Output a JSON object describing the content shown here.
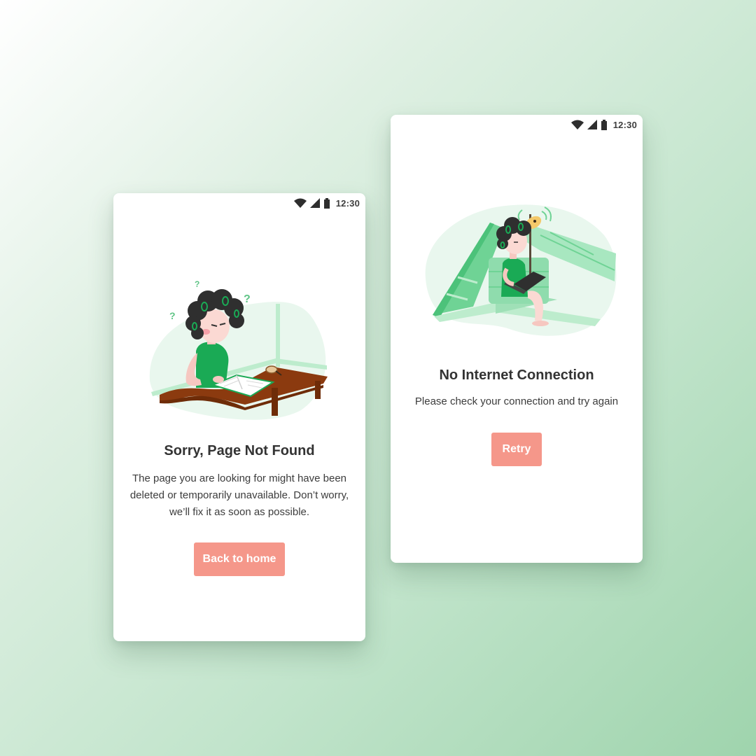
{
  "colors": {
    "background_start": "#ffffff",
    "background_end": "#9fd4ad",
    "button": "#f5978a",
    "accent_green": "#1aaa55",
    "mint": "#bdeccd"
  },
  "screens": [
    {
      "status_bar": {
        "time": "12:30",
        "icons": [
          "wifi-icon",
          "signal-icon",
          "battery-icon"
        ]
      },
      "illustration": "girl-reading-book-at-desk-confused",
      "title": "Sorry, Page Not Found",
      "message": "The page you are looking for might have been deleted or temporarily unavailable. Don’t worry, we’ll fix it as soon as possible.",
      "button_label": "Back to home"
    },
    {
      "status_bar": {
        "time": "12:30",
        "icons": [
          "wifi-icon",
          "signal-icon",
          "battery-icon"
        ]
      },
      "illustration": "girl-with-laptop-under-tent-and-satellite-dish",
      "title": "No Internet Connection",
      "message": "Please check your connection and try again",
      "button_label": "Retry"
    }
  ]
}
